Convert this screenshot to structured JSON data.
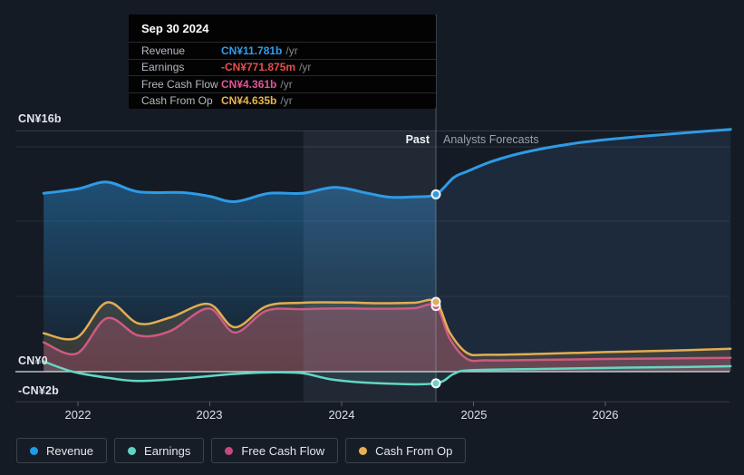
{
  "tooltip": {
    "date": "Sep 30 2024",
    "rows": [
      {
        "label": "Revenue",
        "value": "CN¥11.781b",
        "suffix": "/yr",
        "color": "#2e9ded"
      },
      {
        "label": "Earnings",
        "value": "-CN¥771.875m",
        "suffix": "/yr",
        "color": "#e4504b"
      },
      {
        "label": "Free Cash Flow",
        "value": "CN¥4.361b",
        "suffix": "/yr",
        "color": "#e0559c"
      },
      {
        "label": "Cash From Op",
        "value": "CN¥4.635b",
        "suffix": "/yr",
        "color": "#e9b451"
      }
    ]
  },
  "labels": {
    "past": "Past",
    "forecast": "Analysts Forecasts"
  },
  "y_axis": {
    "top": "CN¥16b",
    "zero": "CN¥0",
    "neg": "-CN¥2b"
  },
  "x_axis": {
    "years": [
      "2022",
      "2023",
      "2024",
      "2025",
      "2026"
    ]
  },
  "legend": [
    {
      "label": "Revenue",
      "color": "#1e9ceb"
    },
    {
      "label": "Earnings",
      "color": "#5ed5c4"
    },
    {
      "label": "Free Cash Flow",
      "color": "#c64a7c"
    },
    {
      "label": "Cash From Op",
      "color": "#e6b150"
    }
  ],
  "chart_data": {
    "type": "area",
    "unit": "CN¥ billions per year",
    "x_domain": [
      2021.74,
      2026.95
    ],
    "divider_x": 2024.715,
    "band_x": [
      2023.71,
      2024.715
    ],
    "ylim": [
      -2.8,
      17.2
    ],
    "gridline_values": [
      16,
      10,
      5,
      0,
      -2
    ],
    "series": [
      {
        "name": "Revenue",
        "color": "#2e9be6",
        "past": [
          [
            2021.74,
            11.85
          ],
          [
            2022.0,
            12.15
          ],
          [
            2022.22,
            12.6
          ],
          [
            2022.46,
            11.95
          ],
          [
            2022.8,
            11.9
          ],
          [
            2023.0,
            11.65
          ],
          [
            2023.19,
            11.3
          ],
          [
            2023.45,
            11.85
          ],
          [
            2023.7,
            11.85
          ],
          [
            2023.95,
            12.25
          ],
          [
            2024.2,
            11.85
          ],
          [
            2024.36,
            11.6
          ],
          [
            2024.55,
            11.62
          ],
          [
            2024.715,
            11.781
          ]
        ],
        "forecast": [
          [
            2024.715,
            11.781
          ],
          [
            2024.85,
            12.9
          ],
          [
            2024.95,
            13.3
          ],
          [
            2025.15,
            14.0
          ],
          [
            2025.4,
            14.6
          ],
          [
            2025.75,
            15.15
          ],
          [
            2026.1,
            15.5
          ],
          [
            2026.5,
            15.8
          ],
          [
            2026.95,
            16.1
          ]
        ]
      },
      {
        "name": "Cash From Op",
        "color": "#e3ad52",
        "past": [
          [
            2021.74,
            2.55
          ],
          [
            2021.99,
            2.25
          ],
          [
            2022.22,
            4.6
          ],
          [
            2022.46,
            3.2
          ],
          [
            2022.7,
            3.6
          ],
          [
            2022.99,
            4.5
          ],
          [
            2023.19,
            2.95
          ],
          [
            2023.43,
            4.35
          ],
          [
            2023.7,
            4.58
          ],
          [
            2024.0,
            4.6
          ],
          [
            2024.3,
            4.55
          ],
          [
            2024.55,
            4.58
          ],
          [
            2024.715,
            4.635
          ]
        ],
        "forecast": [
          [
            2024.715,
            4.635
          ],
          [
            2024.82,
            2.6
          ],
          [
            2024.95,
            1.25
          ],
          [
            2025.1,
            1.12
          ],
          [
            2025.5,
            1.18
          ],
          [
            2026.0,
            1.3
          ],
          [
            2026.5,
            1.4
          ],
          [
            2026.95,
            1.52
          ]
        ]
      },
      {
        "name": "Free Cash Flow",
        "color": "#cd5a82",
        "past": [
          [
            2021.74,
            1.95
          ],
          [
            2021.99,
            1.2
          ],
          [
            2022.22,
            3.55
          ],
          [
            2022.46,
            2.4
          ],
          [
            2022.7,
            2.7
          ],
          [
            2022.99,
            4.2
          ],
          [
            2023.19,
            2.6
          ],
          [
            2023.43,
            4.05
          ],
          [
            2023.7,
            4.15
          ],
          [
            2024.0,
            4.2
          ],
          [
            2024.3,
            4.18
          ],
          [
            2024.55,
            4.22
          ],
          [
            2024.715,
            4.361
          ]
        ],
        "forecast": [
          [
            2024.715,
            4.361
          ],
          [
            2024.82,
            2.2
          ],
          [
            2024.95,
            0.85
          ],
          [
            2025.1,
            0.75
          ],
          [
            2025.5,
            0.78
          ],
          [
            2026.0,
            0.84
          ],
          [
            2026.5,
            0.88
          ],
          [
            2026.95,
            0.92
          ]
        ]
      },
      {
        "name": "Earnings",
        "color": "#64d6c4",
        "past": [
          [
            2021.74,
            0.68
          ],
          [
            2021.96,
            0.0
          ],
          [
            2022.22,
            -0.4
          ],
          [
            2022.46,
            -0.62
          ],
          [
            2022.8,
            -0.45
          ],
          [
            2023.19,
            -0.15
          ],
          [
            2023.45,
            -0.05
          ],
          [
            2023.7,
            -0.1
          ],
          [
            2023.95,
            -0.55
          ],
          [
            2024.36,
            -0.8
          ],
          [
            2024.715,
            -0.772
          ]
        ],
        "forecast": [
          [
            2024.715,
            -0.772
          ],
          [
            2024.85,
            -0.15
          ],
          [
            2024.98,
            0.1
          ],
          [
            2025.5,
            0.18
          ],
          [
            2026.0,
            0.25
          ],
          [
            2026.5,
            0.3
          ],
          [
            2026.95,
            0.36
          ]
        ]
      }
    ],
    "markers": [
      {
        "name": "Revenue",
        "x": 2024.715,
        "value": 11.781
      },
      {
        "name": "Free Cash Flow",
        "x": 2024.715,
        "value": 4.361
      },
      {
        "name": "Cash From Op",
        "x": 2024.715,
        "value": 4.635
      },
      {
        "name": "Earnings",
        "x": 2024.715,
        "value": -0.772
      }
    ]
  }
}
